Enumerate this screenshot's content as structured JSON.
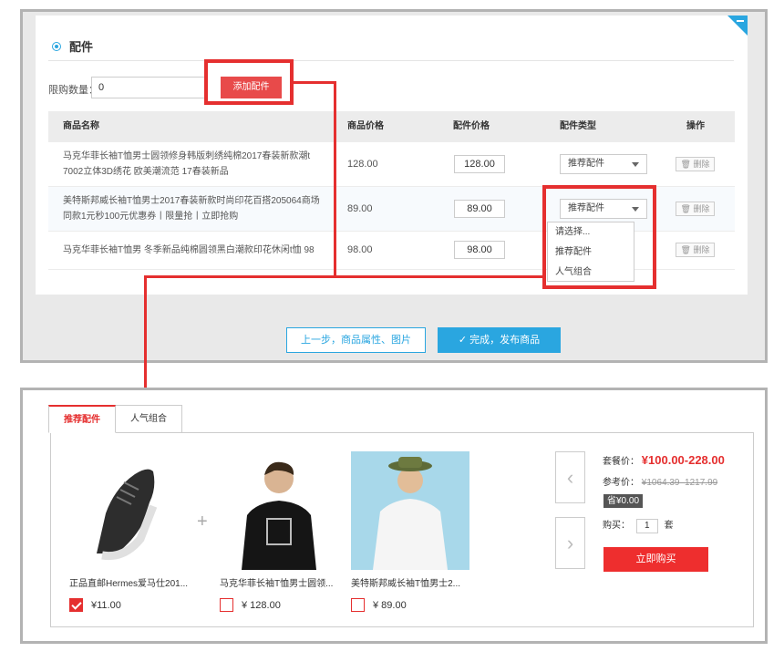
{
  "section": {
    "title": "配件"
  },
  "limit": {
    "label": "限购数量：",
    "value": "0"
  },
  "add_button": "添加配件",
  "table": {
    "headers": [
      "商品名称",
      "商品价格",
      "配件价格",
      "配件类型",
      "操作"
    ],
    "rows": [
      {
        "name": "马克华菲长袖T恤男士圆领修身韩版刺绣纯棉2017春装新款潮t 7002立体3D绣花 欧美潮流范 17春装新品",
        "price": "128.00",
        "accessory_price": "128.00",
        "type": "推荐配件",
        "action": "删除"
      },
      {
        "name": "美特斯邦威长袖T恤男士2017春装新款时尚印花百搭205064商场同款1元秒100元优惠券丨限量抢丨立即抢购",
        "price": "89.00",
        "accessory_price": "89.00",
        "type": "推荐配件",
        "action": "删除"
      },
      {
        "name": "马克华菲长袖T恤男 冬季新品纯棉圆领黑白潮款印花休闲t恤 98",
        "price": "98.00",
        "accessory_price": "98.00",
        "type": "推荐配件",
        "action": "删除"
      }
    ]
  },
  "dropdown_options": [
    "请选择...",
    "推荐配件",
    "人气组合"
  ],
  "buttons": {
    "prev": "上一步，商品属性、图片",
    "done": "完成，发布商品"
  },
  "tabs": [
    "推荐配件",
    "人气组合"
  ],
  "combo": {
    "products": [
      {
        "name": "正品直邮Hermes爱马仕201...",
        "price": "¥11.00",
        "checked": true
      },
      {
        "name": "马克华菲长袖T恤男士圆领...",
        "price": "¥ 128.00",
        "checked": false
      },
      {
        "name": "美特斯邦威长袖T恤男士2...",
        "price": "¥ 89.00",
        "checked": false
      }
    ],
    "package_label": "套餐价：",
    "package_price": "¥100.00-228.00",
    "ref_label": "参考价：",
    "ref_price": "¥1064.39–1217.99",
    "save": "省¥0.00",
    "buy_label": "购买：",
    "qty": "1",
    "unit": "套",
    "buy_button": "立即购买"
  },
  "colors": {
    "accent": "#2aa6e0",
    "highlight": "#e52f2f",
    "buy": "#ee2e2e"
  }
}
